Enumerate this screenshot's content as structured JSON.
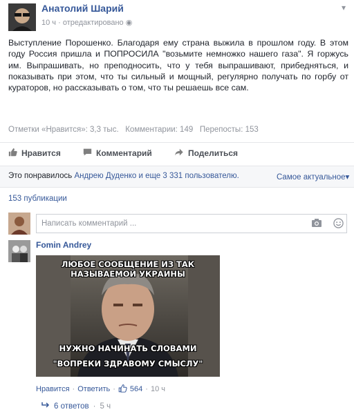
{
  "post": {
    "author": "Анатолий Шарий",
    "time": "10 ч",
    "edited": "отредактировано",
    "text": "Выступление Порошенко. Благодаря ему страна выжила в прошлом году. В этом году Россия пришла и ПОПРОСИЛА \"возьмите немножко нашего газа\". Я горжусь им. Выпрашивать, но преподносить, что у тебя выпрашивают, прибедняться, и показывать при этом, что ты сильный и мощный, регулярно получать по горбу от кураторов, но рассказывать о том, что ты решаешь все сам."
  },
  "stats": {
    "likes": "Отметки «Нравится»: 3,3 тыс.",
    "comments": "Комментарии: 149",
    "shares": "Перепосты: 153"
  },
  "actions": {
    "like": "Нравится",
    "comment": "Комментарий",
    "share": "Поделиться"
  },
  "likebar": {
    "prefix": "Это понравилось",
    "names": "Андрею Дуденко и еще 3 331 пользователю.",
    "sort": "Самое актуальное"
  },
  "publications": "153 публикации",
  "composer": {
    "placeholder": "Написать комментарий ..."
  },
  "comment": {
    "author": "Fomin Andrey",
    "meme_top": "Любое сообщение из так называемой Украины",
    "meme_bottom_1": "Нужно начинать словами",
    "meme_bottom_2": "\"вопреки здравому смыслу\"",
    "like": "Нравится",
    "reply": "Ответить",
    "reactions": "564",
    "time": "10 ч",
    "replies": "6 ответов",
    "replies_time": "5 ч"
  }
}
